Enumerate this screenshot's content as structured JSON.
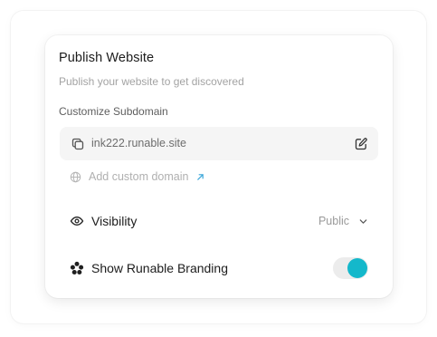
{
  "dialog": {
    "title": "Publish Website",
    "subtitle": "Publish your website to get discovered",
    "subdomain_label": "Customize Subdomain",
    "subdomain_value": "ink222.runable.site",
    "custom_domain_label": "Add custom domain",
    "visibility": {
      "label": "Visibility",
      "value": "Public"
    },
    "branding": {
      "label": "Show Runable Branding",
      "enabled": true
    }
  },
  "colors": {
    "accent": "#14b8cb",
    "link_arrow": "#3aa6d9",
    "muted_text": "#a3a3a3"
  },
  "icons": [
    "copy-icon",
    "edit-icon",
    "globe-icon",
    "external-arrow-icon",
    "eye-icon",
    "chevron-down-icon",
    "runable-logo-icon"
  ]
}
